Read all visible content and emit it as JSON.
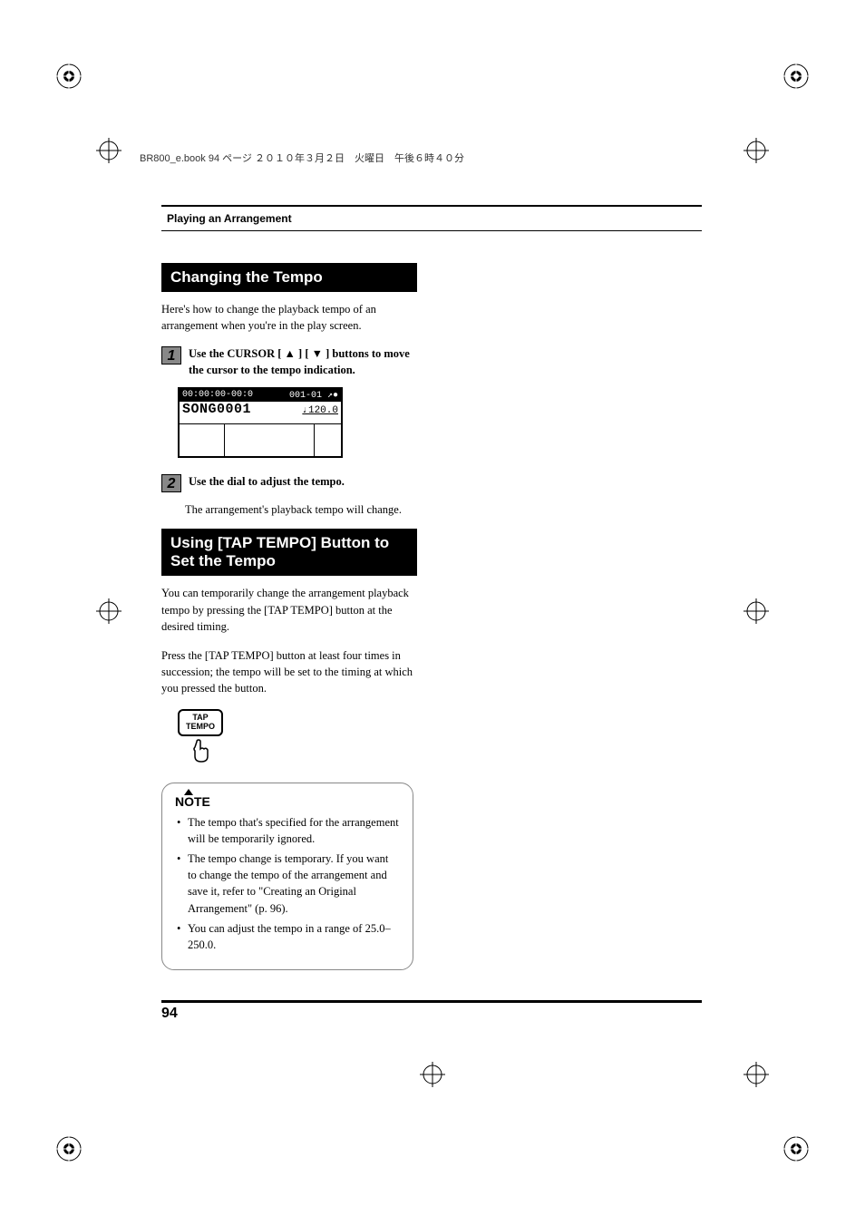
{
  "book_header": "BR800_e.book 94 ページ ２０１０年３月２日　火曜日　午後６時４０分",
  "page_rule_title": "Playing an Arrangement",
  "section1": {
    "heading": "Changing the Tempo",
    "intro": "Here's how to change the playback tempo of an arrangement when you're in the play screen.",
    "step1_text": "Use the CURSOR [ ▲ ] [ ▼ ] buttons to move the cursor to the tempo indication.",
    "step2_text": "Use the dial to adjust the tempo.",
    "step2_body": "The arrangement's playback tempo will change."
  },
  "lcd": {
    "time": "00:00:00-00:0",
    "measure": "001-01",
    "song": "SONG0001",
    "tempo_note": "♩",
    "tempo_val": "120.0"
  },
  "section2": {
    "heading": "Using [TAP TEMPO] Button to Set the Tempo",
    "para1": "You can temporarily change the arrangement playback tempo by pressing the [TAP TEMPO] button at the desired timing.",
    "para2": "Press the [TAP TEMPO] button at least four times in succession; the tempo will be set to the timing at which you pressed the button."
  },
  "tap_button": {
    "line1": "TAP",
    "line2": "TEMPO"
  },
  "note": {
    "title": "NOTE",
    "items": [
      "The tempo that's specified for the arrangement will be temporarily ignored.",
      "The tempo change is temporary. If you want to change the tempo of the arrangement and save it, refer to \"Creating an Original Arrangement\" (p. 96).",
      "You can adjust the tempo in a range of 25.0–250.0."
    ]
  },
  "page_number": "94"
}
